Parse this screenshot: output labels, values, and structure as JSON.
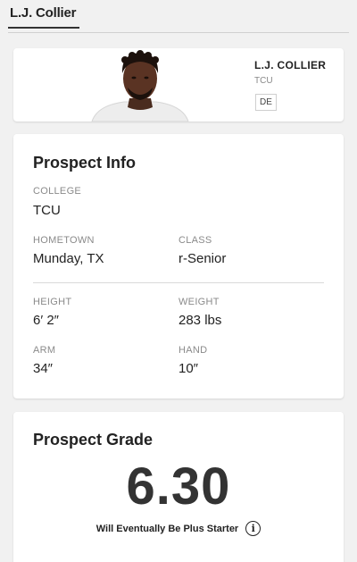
{
  "tabs": [
    {
      "label": "L.J. Collier",
      "active": true
    }
  ],
  "player": {
    "name": "L.J. COLLIER",
    "school": "TCU",
    "position": "DE",
    "photo": "player-headshot"
  },
  "prospect_info": {
    "title": "Prospect Info",
    "college": {
      "label": "COLLEGE",
      "value": "TCU"
    },
    "hometown": {
      "label": "HOMETOWN",
      "value": "Munday, TX"
    },
    "class": {
      "label": "CLASS",
      "value": "r-Senior"
    },
    "height": {
      "label": "HEIGHT",
      "value": "6′ 2″"
    },
    "weight": {
      "label": "WEIGHT",
      "value": "283 lbs"
    },
    "arm": {
      "label": "ARM",
      "value": "34″"
    },
    "hand": {
      "label": "HAND",
      "value": "10″"
    }
  },
  "prospect_grade": {
    "title": "Prospect Grade",
    "value": "6.30",
    "description": "Will Eventually Be Plus Starter",
    "info_icon": "info-circle-icon"
  },
  "colors": {
    "background": "#f1f1f1",
    "card": "#ffffff",
    "text": "#222222",
    "label": "#8a8a8a"
  }
}
